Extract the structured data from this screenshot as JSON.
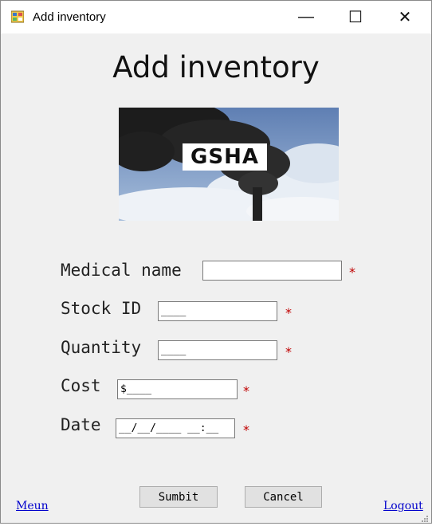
{
  "window": {
    "title": "Add inventory",
    "controls": {
      "minimize": "—",
      "maximize": "☐",
      "close": "✕"
    }
  },
  "heading": "Add inventory",
  "banner": {
    "logo_text": "GSHA"
  },
  "form": {
    "required_mark": "*",
    "fields": [
      {
        "label": "Medical name",
        "value": ""
      },
      {
        "label": "Stock ID",
        "value": "____"
      },
      {
        "label": "Quantity",
        "value": "____"
      },
      {
        "label": "Cost",
        "value": "$____"
      },
      {
        "label": "Date",
        "value": "__/__/____ __:__"
      }
    ]
  },
  "buttons": {
    "submit": "Sumbit",
    "cancel": "Cancel"
  },
  "links": {
    "menu": "Meun",
    "logout": "Logout"
  }
}
